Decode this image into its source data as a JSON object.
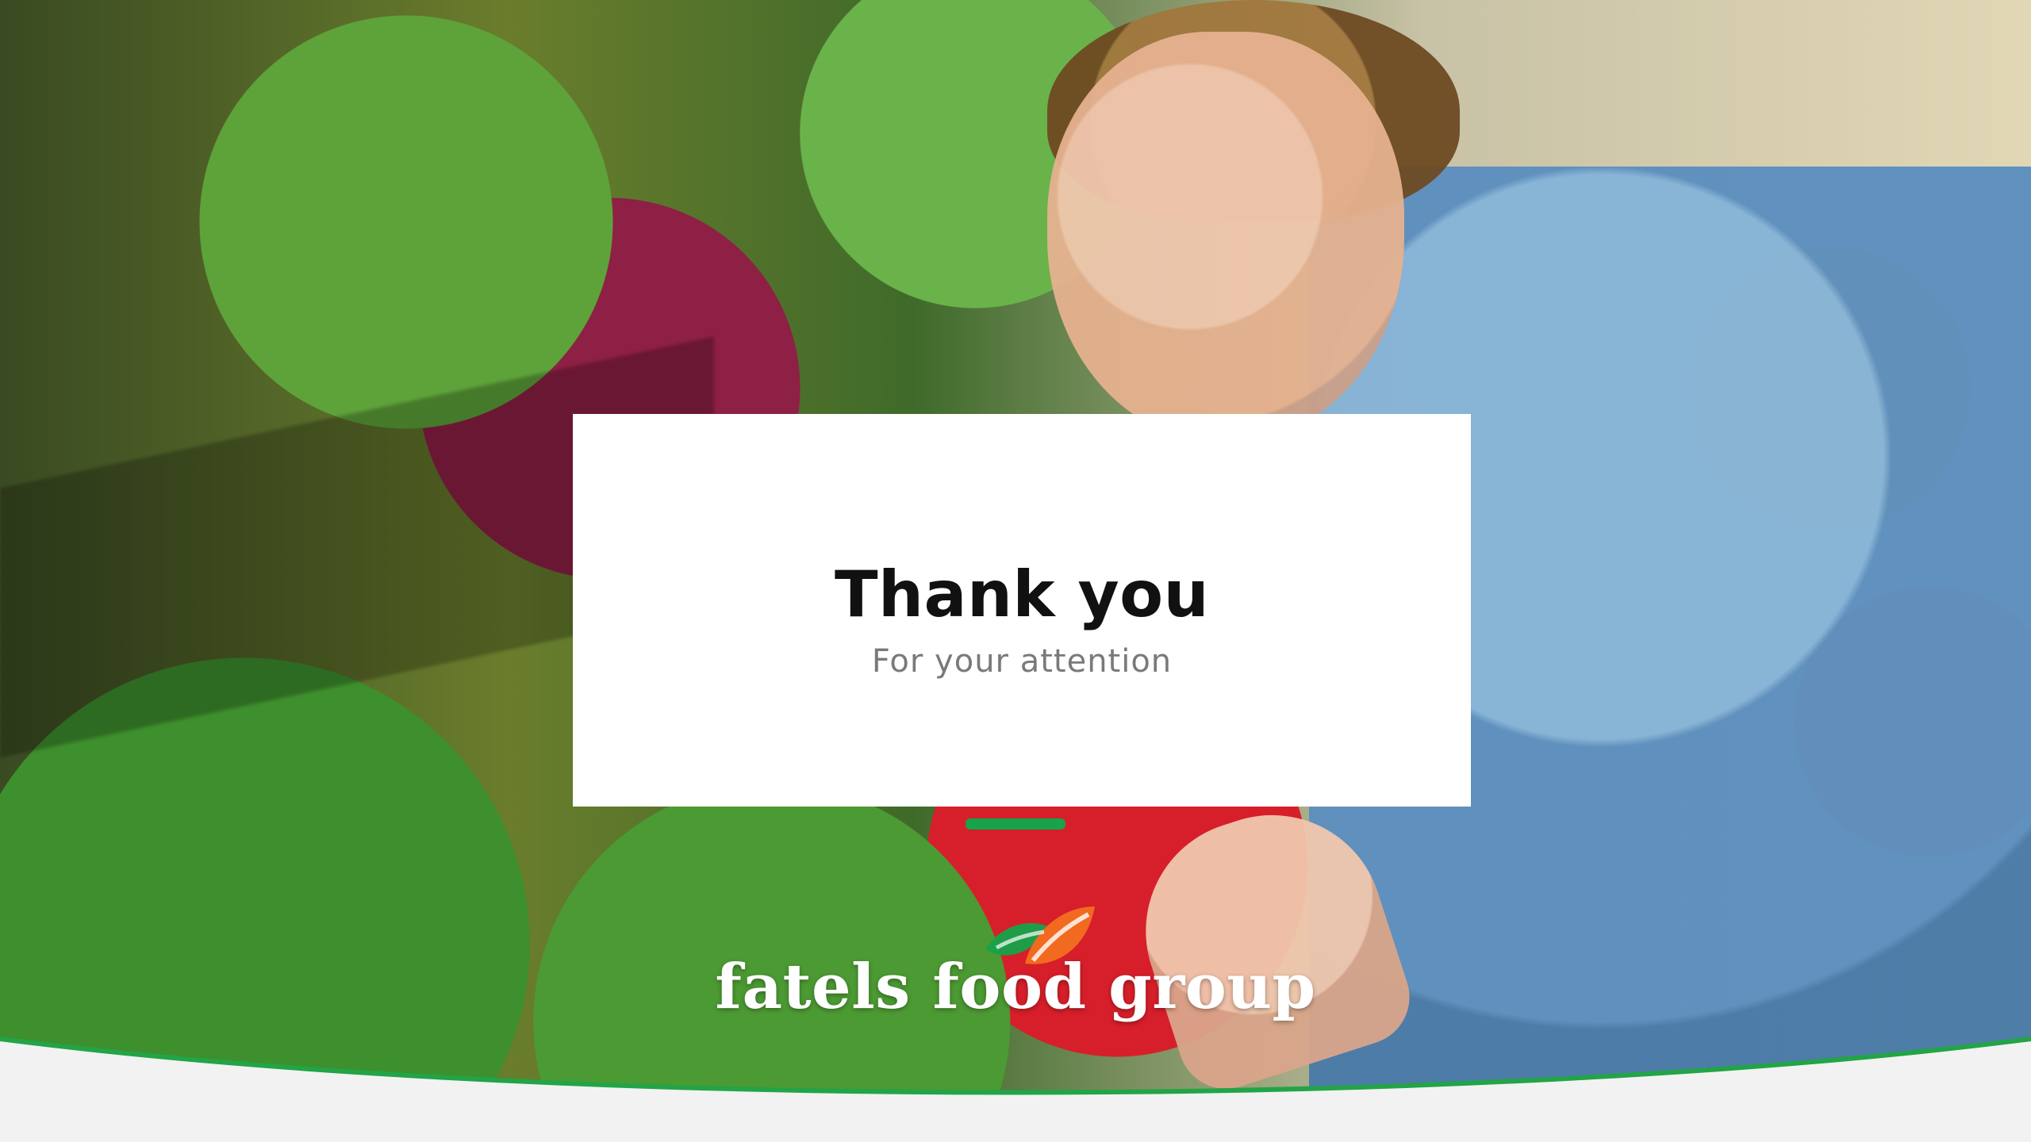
{
  "slide": {
    "title": "Thank you",
    "subtitle": "For your attention"
  },
  "brand": {
    "name": "fatels food group",
    "colors": {
      "green": "#16a34a",
      "orange": "#f26b21"
    }
  },
  "theme": {
    "background": "#f2f2f2",
    "card": "#ffffff",
    "curve_stroke": "#22a447"
  }
}
